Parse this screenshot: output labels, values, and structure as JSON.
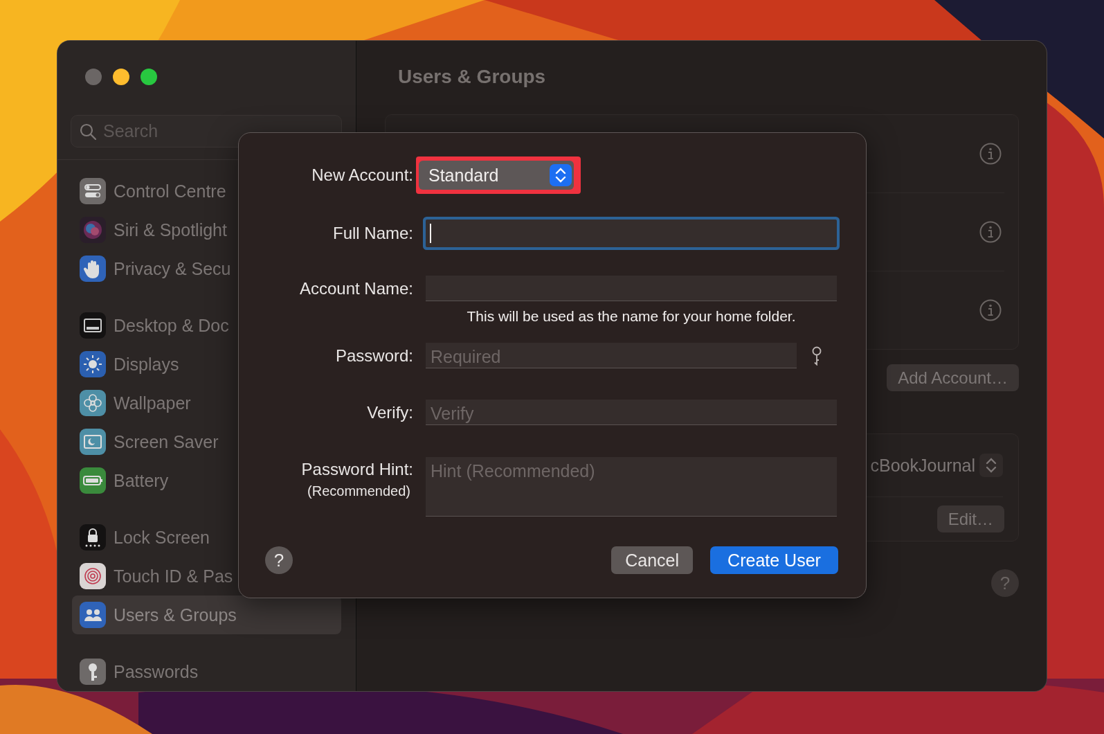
{
  "window": {
    "traffic_lights": [
      {
        "kind": "close",
        "enabled": false
      },
      {
        "kind": "minimize",
        "enabled": true
      },
      {
        "kind": "zoom",
        "enabled": true
      }
    ]
  },
  "sidebar": {
    "search": {
      "placeholder": "Search"
    },
    "groups": [
      {
        "items": [
          {
            "label": "Control Centre",
            "kind": "control-centre",
            "selected": false
          },
          {
            "label": "Siri & Spotlight",
            "kind": "siri",
            "selected": false
          },
          {
            "label": "Privacy & Secu",
            "kind": "privacy",
            "selected": false
          }
        ]
      },
      {
        "items": [
          {
            "label": "Desktop & Doc",
            "kind": "desktop",
            "selected": false
          },
          {
            "label": "Displays",
            "kind": "displays",
            "selected": false
          },
          {
            "label": "Wallpaper",
            "kind": "wallpaper",
            "selected": false
          },
          {
            "label": "Screen Saver",
            "kind": "screen-saver",
            "selected": false
          },
          {
            "label": "Battery",
            "kind": "battery",
            "selected": false
          }
        ]
      },
      {
        "items": [
          {
            "label": "Lock Screen",
            "kind": "lock-screen",
            "selected": false
          },
          {
            "label": "Touch ID & Pas",
            "kind": "touch-id",
            "selected": false
          },
          {
            "label": "Users & Groups",
            "kind": "users",
            "selected": true
          }
        ]
      },
      {
        "items": [
          {
            "label": "Passwords",
            "kind": "passwords",
            "selected": false
          }
        ]
      }
    ]
  },
  "main": {
    "title": "Users & Groups",
    "user_rows": [
      {
        "info_button": true
      },
      {
        "info_button": true
      },
      {
        "info_button": true
      }
    ],
    "add_account_button": "Add Account…",
    "login_popup": {
      "value": "cBookJournal"
    },
    "edit_button": "Edit…",
    "help_button": "?"
  },
  "dialog": {
    "rows": [
      {
        "kind": "popup",
        "label": "New Account:",
        "value": "Standard",
        "highlighted": true
      },
      {
        "kind": "text",
        "label": "Full Name:",
        "focused": true
      },
      {
        "kind": "text",
        "label": "Account Name:",
        "note": "This will be used as the name for your home folder."
      },
      {
        "kind": "password",
        "label": "Password:",
        "placeholder": "Required",
        "key_button": true
      },
      {
        "kind": "text",
        "label": "Verify:",
        "placeholder": "Verify"
      },
      {
        "kind": "textarea",
        "label": "Password Hint:",
        "sublabel": "(Recommended)",
        "placeholder": "Hint (Recommended)"
      }
    ],
    "help_button": "?",
    "buttons": [
      {
        "label": "Cancel",
        "default": false
      },
      {
        "label": "Create User",
        "default": true
      }
    ]
  }
}
